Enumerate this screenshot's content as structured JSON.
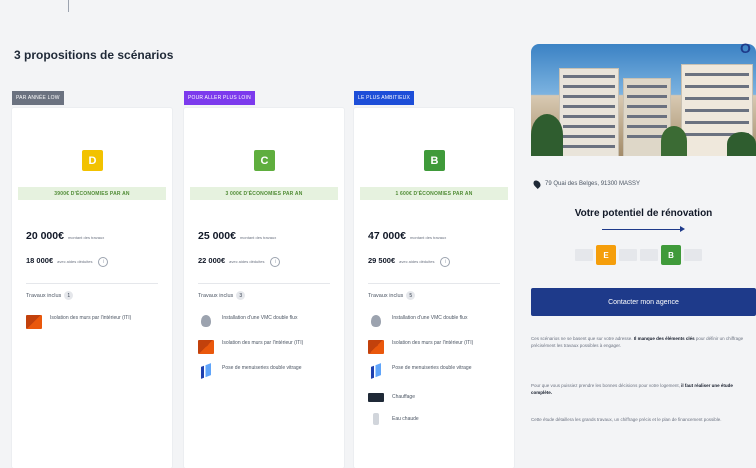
{
  "section_title": "3 propositions de scénarios",
  "scenarios": [
    {
      "label": "PAR ANNÉE LOW",
      "label_color": "#6b7280",
      "badge": "D",
      "badge_color": "#f2c200",
      "savings": "3900€ D'ÉCONOMIES PAR AN",
      "price_main": "20 000€",
      "price_main_note": "montant des travaux",
      "price_sub": "18 000€",
      "price_sub_note": "avec aides déduites",
      "works_title": "Travaux inclus",
      "works_count": "1",
      "works": [
        {
          "icon": "wall-insulation-icon",
          "text": "Isolation des murs par l'intérieur (ITI)"
        }
      ]
    },
    {
      "label": "POUR ALLER PLUS LOIN",
      "label_color": "#7c3aed",
      "badge": "C",
      "badge_color": "#5fae3e",
      "savings": "3 000€ D'ÉCONOMIES PAR AN",
      "price_main": "25 000€",
      "price_main_note": "montant des travaux",
      "price_sub": "22 000€",
      "price_sub_note": "avec aides déduites",
      "works_title": "Travaux inclus",
      "works_count": "3",
      "works": [
        {
          "icon": "vmc-icon",
          "text": "Installation d'une VMC double flux"
        },
        {
          "icon": "wall-insulation-icon",
          "text": "Isolation des murs par l'intérieur (ITI)"
        },
        {
          "icon": "window-icon",
          "text": "Pose de menuiseries double vitrage"
        }
      ]
    },
    {
      "label": "LE PLUS AMBITIEUX",
      "label_color": "#1d4ed8",
      "badge": "B",
      "badge_color": "#3f9a3a",
      "savings": "1 600€ D'ÉCONOMIES PAR AN",
      "price_main": "47 000€",
      "price_main_note": "montant des travaux",
      "price_sub": "29 500€",
      "price_sub_note": "avec aides déduites",
      "works_title": "Travaux inclus",
      "works_count": "5",
      "works": [
        {
          "icon": "vmc-icon",
          "text": "Installation d'une VMC double flux"
        },
        {
          "icon": "wall-insulation-icon",
          "text": "Isolation des murs par l'intérieur (ITI)"
        },
        {
          "icon": "window-icon",
          "text": "Pose de menuiseries double vitrage"
        },
        {
          "icon": "heating-icon",
          "text": "Chauffage"
        },
        {
          "icon": "water-heater-icon",
          "text": "Eau chaude"
        }
      ]
    }
  ],
  "sidebar": {
    "corner_letter": "O",
    "address": "79 Quai des Belges, 91300 MASSY",
    "title": "Votre potentiel de rénovation",
    "from_class": "E",
    "from_color": "#f59e0b",
    "to_class": "B",
    "to_color": "#3f9a3a",
    "cta": "Contacter mon agence",
    "para1_a": "Ces scénarios ne se basent que sur votre adresse.",
    "para1_b": "Il manque des éléments clés",
    "para1_c": "pour définir un chiffrage précisément les travaux possibles à engager.",
    "para2_a": "Pour que vous puissiez prendre les bonnes décisions pour votre logement,",
    "para2_b": "il faut réaliser une étude complète.",
    "para3": "Cette étude détaillera les grands travaux, un chiffrage précis et le plan de financement possible."
  }
}
